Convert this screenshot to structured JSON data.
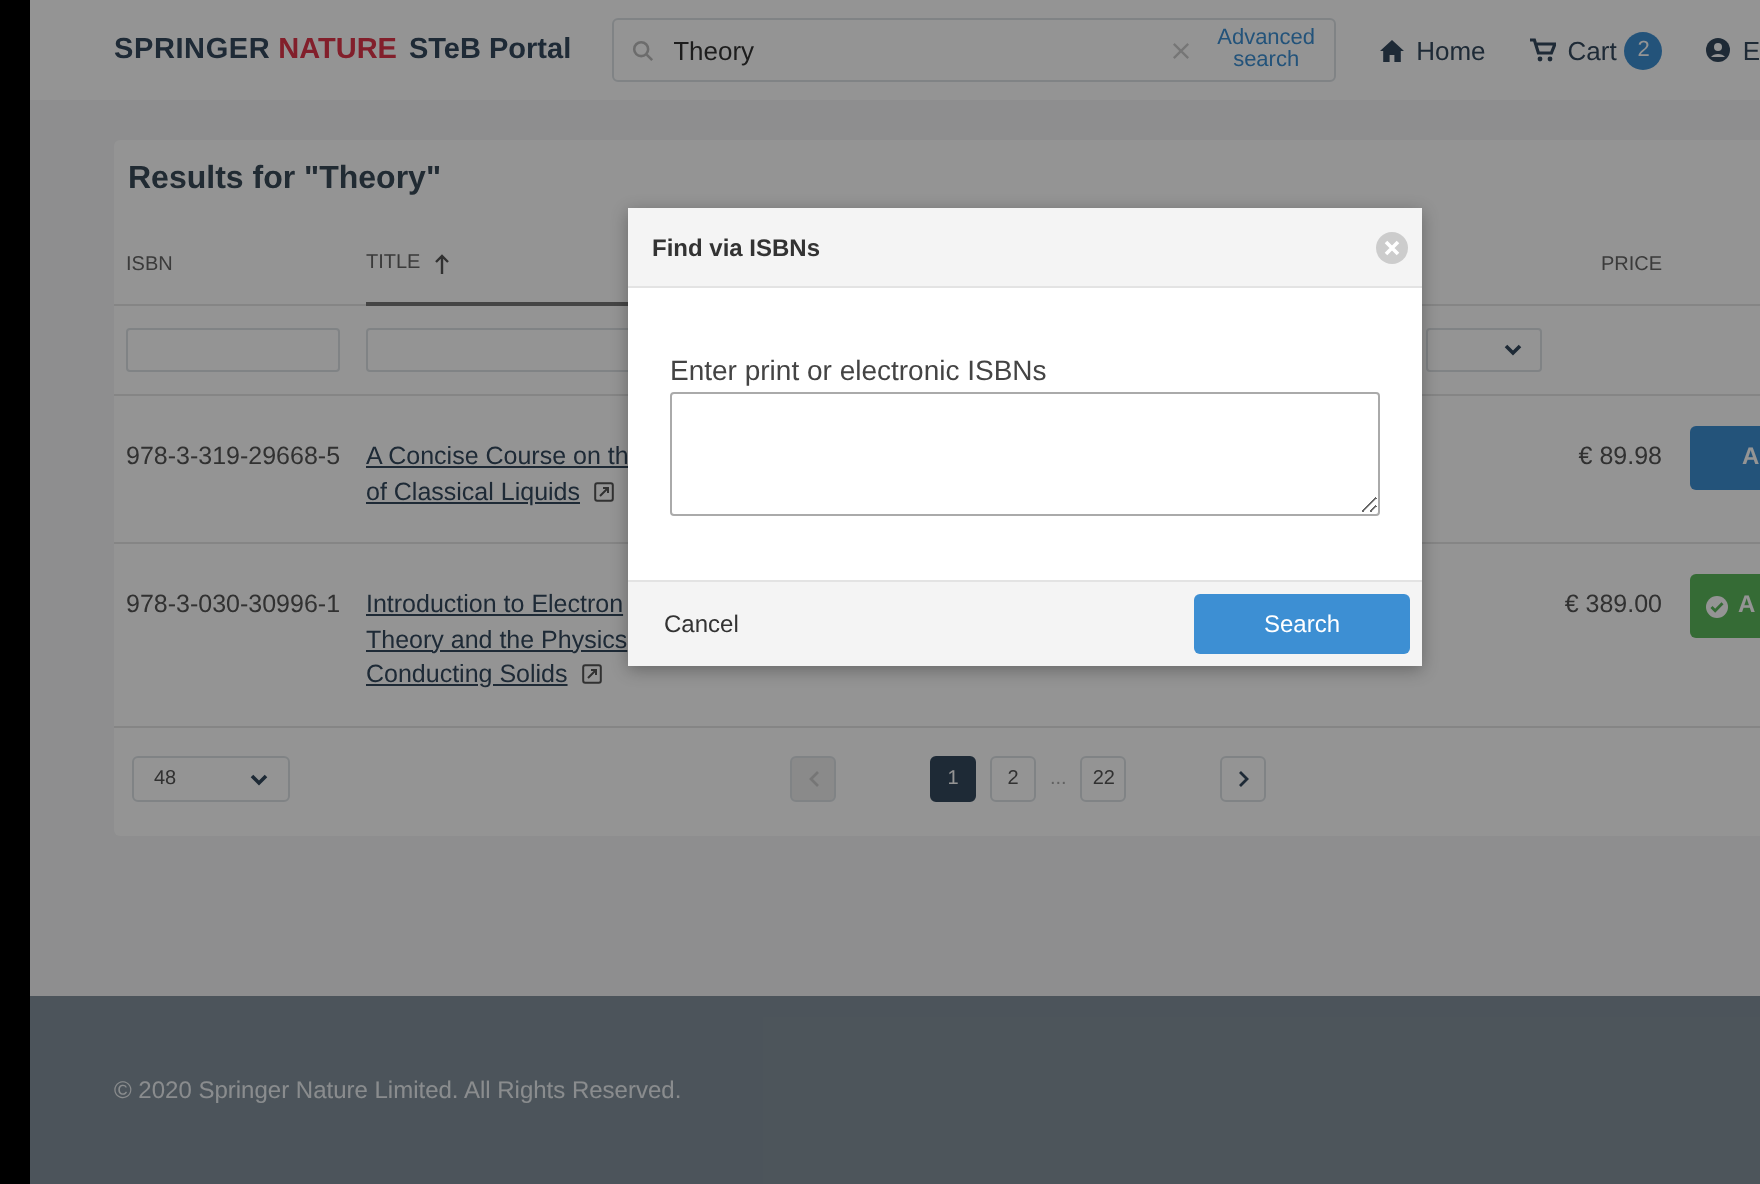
{
  "header": {
    "logo": {
      "part_1": "SPRINGER",
      "part_2": "NATURE",
      "part_3": "STeB Portal"
    },
    "search": {
      "value": "Theory",
      "advanced_link": "Advanced search"
    },
    "nav": [
      {
        "kind": "home",
        "label": "Home"
      },
      {
        "kind": "cart",
        "label": "Cart",
        "badge": "2"
      },
      {
        "kind": "user",
        "label": "E"
      }
    ]
  },
  "results": {
    "title": "Results for \"Theory\"",
    "columns": [
      {
        "label": "ISBN",
        "sorted": false
      },
      {
        "label": "TITLE",
        "sorted": true
      },
      {
        "label": "PRICE",
        "sorted": false
      }
    ],
    "rows": [
      {
        "isbn": "978-3-319-29668-5",
        "title_lines": [
          "A Concise Course on th",
          "of Classical Liquids"
        ],
        "price": "€ 89.98",
        "action": {
          "label": "A",
          "in_cart": false
        }
      },
      {
        "isbn": "978-3-030-30996-1",
        "title_lines": [
          "Introduction to Electron",
          "Theory and the Physics",
          "Conducting Solids"
        ],
        "price": "€ 389.00",
        "action": {
          "label": "A",
          "in_cart": true
        }
      }
    ],
    "pagination": {
      "page_size": "48",
      "prev_disabled": true,
      "next_disabled": false,
      "ellipsis": "...",
      "pages": [
        {
          "label": "1",
          "selected": true
        },
        {
          "label": "2",
          "selected": false
        },
        {
          "label": "22",
          "selected": false
        }
      ]
    }
  },
  "footer": {
    "copyright": "© 2020 Springer Nature Limited. All Rights Reserved."
  },
  "modal": {
    "title": "Find via ISBNs",
    "label": "Enter print or electronic ISBNs",
    "cancel": "Cancel",
    "submit": "Search"
  }
}
